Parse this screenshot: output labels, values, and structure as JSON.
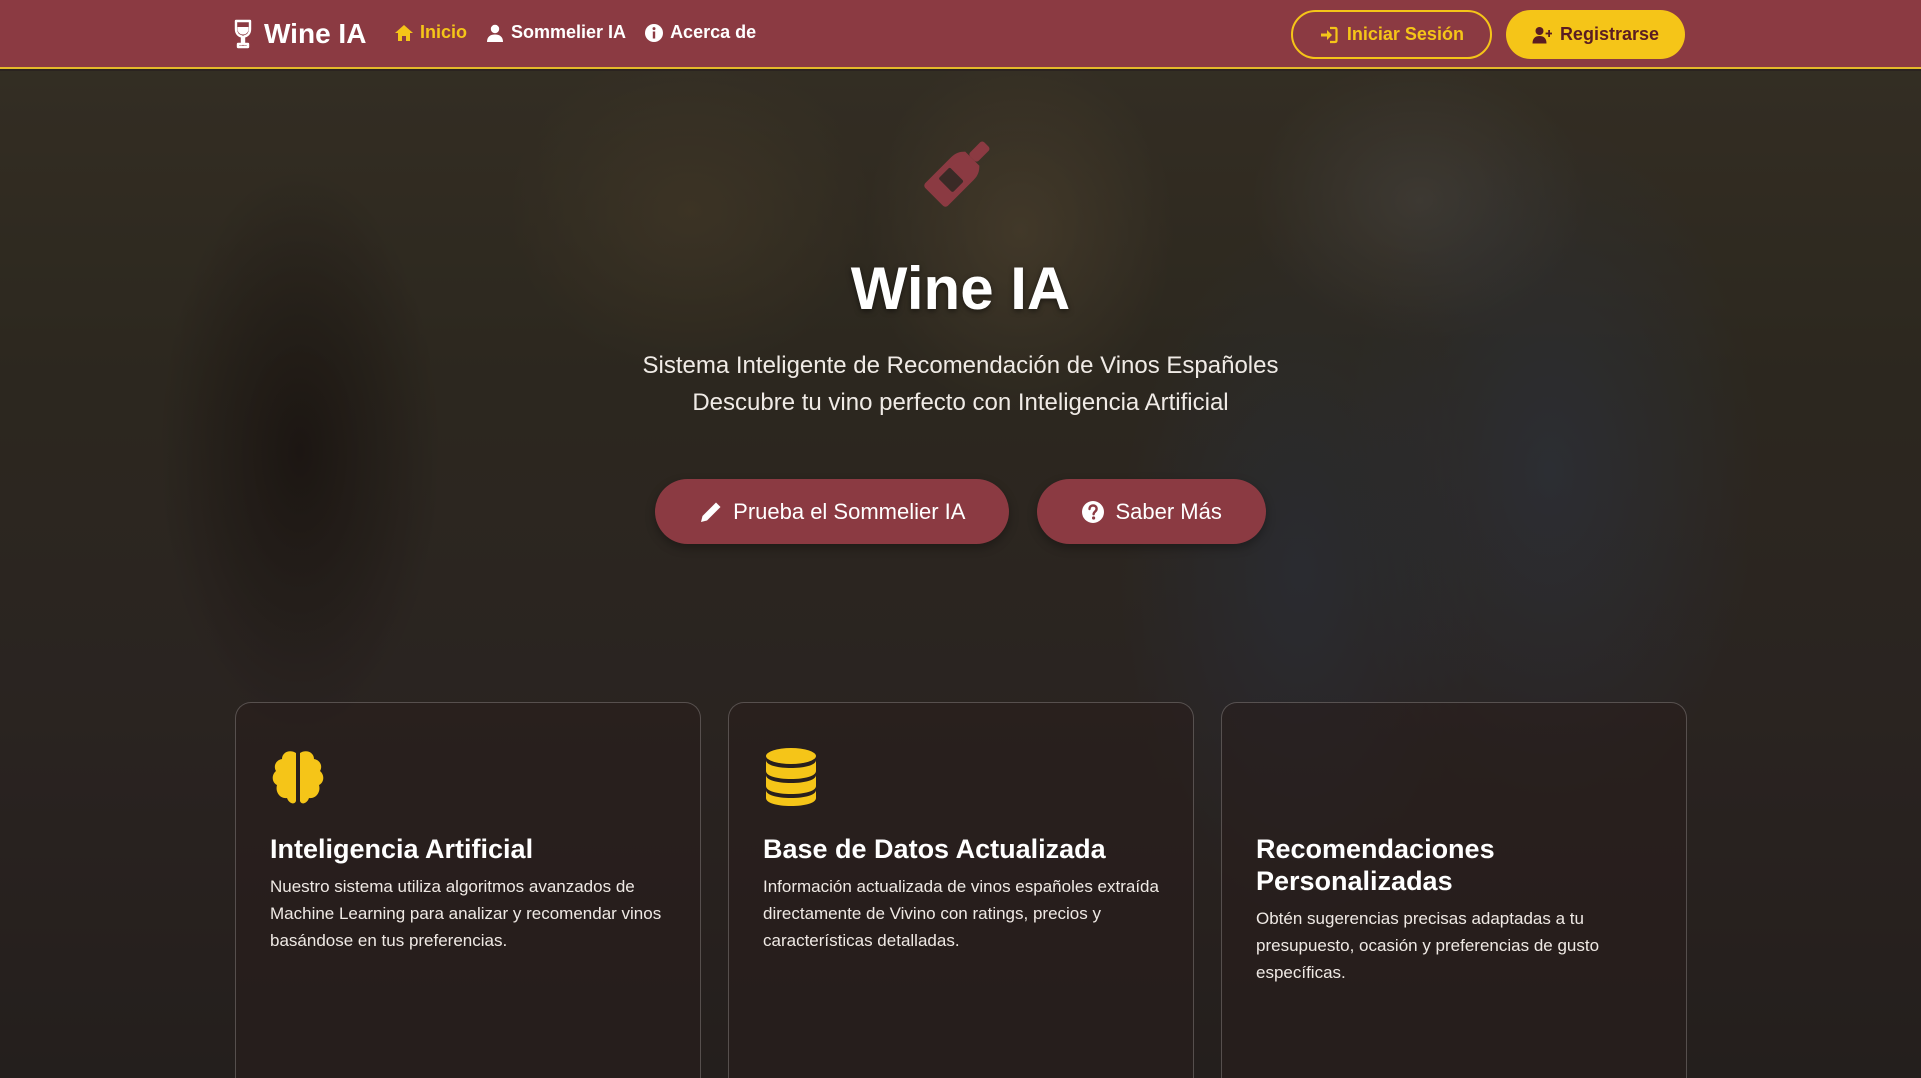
{
  "navbar": {
    "brand": "Wine IA",
    "links": [
      {
        "label": "Inicio",
        "icon": "home-icon",
        "active": true
      },
      {
        "label": "Sommelier IA",
        "icon": "user-icon",
        "active": false
      },
      {
        "label": "Acerca de",
        "icon": "info-icon",
        "active": false
      }
    ],
    "login_label": "Iniciar Sesión",
    "register_label": "Registrarse"
  },
  "hero": {
    "icon": "wine-bottle-icon",
    "title": "Wine IA",
    "subtitle_line1": "Sistema Inteligente de Recomendación de Vinos Españoles",
    "subtitle_line2": "Descubre tu vino perfecto con Inteligencia Artificial",
    "primary_button": "Prueba el Sommelier IA",
    "secondary_button": "Saber Más"
  },
  "features": [
    {
      "icon": "brain-icon",
      "title": "Inteligencia Artificial",
      "text": "Nuestro sistema utiliza algoritmos avanzados de Machine Learning para analizar y recomendar vinos basándose en tus preferencias."
    },
    {
      "icon": "database-icon",
      "title": "Base de Datos Actualizada",
      "text": "Información actualizada de vinos españoles extraída directamente de Vivino con ratings, precios y características detalladas."
    },
    {
      "icon": "",
      "title": "Recomendaciones Personalizadas",
      "text": "Obtén sugerencias precisas adaptadas a tu presupuesto, ocasión y preferencias de gusto específicas."
    }
  ],
  "colors": {
    "primary": "#8b3a42",
    "accent": "#f5c518"
  }
}
